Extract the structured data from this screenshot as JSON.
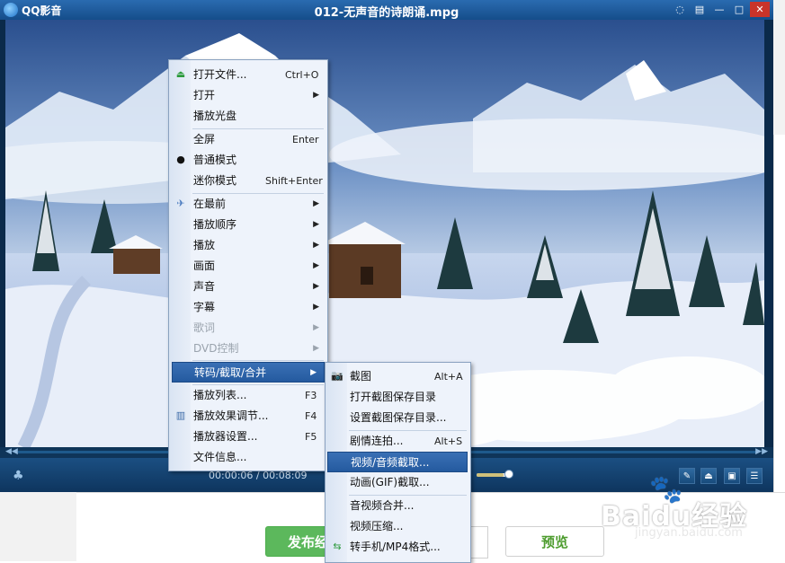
{
  "app": {
    "name": "QQ影音",
    "window_title": "012-无声音的诗朗诵.mpg"
  },
  "window_buttons": {
    "skin_icon": "skin-icon",
    "menu_icon": "menu-icon",
    "minimize": "—",
    "maximize": "□",
    "close": "✕"
  },
  "player": {
    "time": "00:00:06 / 00:08:09",
    "volume_level": 0.82
  },
  "context_menu": {
    "items": [
      {
        "label": "打开文件...",
        "shortcut": "Ctrl+O",
        "icon": "eject-icon"
      },
      {
        "label": "打开",
        "submenu": true
      },
      {
        "label": "播放光盘"
      },
      {
        "label": "全屏",
        "shortcut": "Enter"
      },
      {
        "label": "普通模式",
        "checked": true
      },
      {
        "label": "迷你模式",
        "shortcut": "Shift+Enter"
      },
      {
        "label": "在最前",
        "submenu": true,
        "icon": "pin-icon"
      },
      {
        "label": "播放顺序",
        "submenu": true
      },
      {
        "label": "播放",
        "submenu": true
      },
      {
        "label": "画面",
        "submenu": true
      },
      {
        "label": "声音",
        "submenu": true
      },
      {
        "label": "字幕",
        "submenu": true
      },
      {
        "label": "歌词",
        "submenu": true,
        "disabled": true
      },
      {
        "label": "DVD控制",
        "submenu": true,
        "disabled": true
      },
      {
        "label": "转码/截取/合并",
        "submenu": true,
        "highlighted": true
      },
      {
        "label": "播放列表...",
        "shortcut": "F3"
      },
      {
        "label": "播放效果调节...",
        "shortcut": "F4",
        "icon": "equalizer-icon"
      },
      {
        "label": "播放器设置...",
        "shortcut": "F5"
      },
      {
        "label": "文件信息..."
      }
    ]
  },
  "submenu": {
    "items": [
      {
        "label": "截图",
        "shortcut": "Alt+A",
        "icon": "camera-icon"
      },
      {
        "label": "打开截图保存目录"
      },
      {
        "label": "设置截图保存目录..."
      },
      {
        "label": "剧情连拍...",
        "shortcut": "Alt+S"
      },
      {
        "label": "视频/音频截取...",
        "highlighted": true
      },
      {
        "label": "动画(GIF)截取..."
      },
      {
        "label": "音视频合并..."
      },
      {
        "label": "视频压缩..."
      },
      {
        "label": "转手机/MP4格式...",
        "icon": "phone-convert-icon"
      }
    ]
  },
  "page": {
    "publish_label": "发布经",
    "preview_label": "预览"
  },
  "watermark": {
    "brand": "Baidu",
    "brand_cn": "经验",
    "url": "jingyan.baidu.com"
  }
}
